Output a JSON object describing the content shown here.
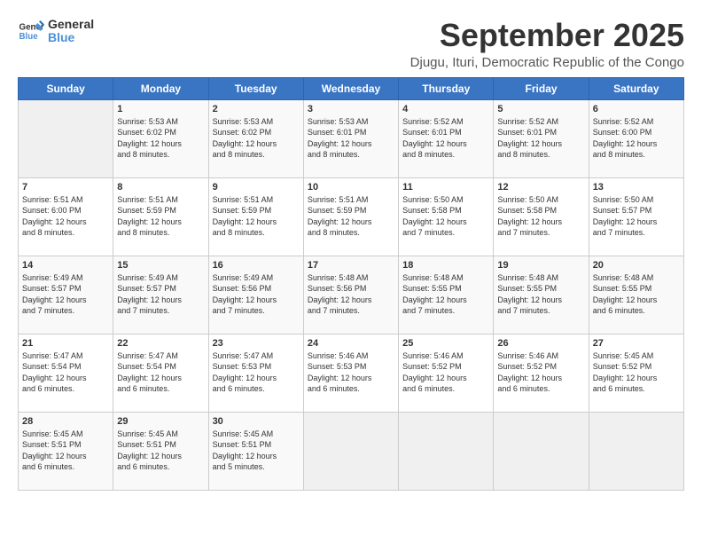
{
  "logo": {
    "line1": "General",
    "line2": "Blue"
  },
  "title": "September 2025",
  "subtitle": "Djugu, Ituri, Democratic Republic of the Congo",
  "days_of_week": [
    "Sunday",
    "Monday",
    "Tuesday",
    "Wednesday",
    "Thursday",
    "Friday",
    "Saturday"
  ],
  "weeks": [
    [
      {
        "day": "",
        "info": ""
      },
      {
        "day": "1",
        "info": "Sunrise: 5:53 AM\nSunset: 6:02 PM\nDaylight: 12 hours\nand 8 minutes."
      },
      {
        "day": "2",
        "info": "Sunrise: 5:53 AM\nSunset: 6:02 PM\nDaylight: 12 hours\nand 8 minutes."
      },
      {
        "day": "3",
        "info": "Sunrise: 5:53 AM\nSunset: 6:01 PM\nDaylight: 12 hours\nand 8 minutes."
      },
      {
        "day": "4",
        "info": "Sunrise: 5:52 AM\nSunset: 6:01 PM\nDaylight: 12 hours\nand 8 minutes."
      },
      {
        "day": "5",
        "info": "Sunrise: 5:52 AM\nSunset: 6:01 PM\nDaylight: 12 hours\nand 8 minutes."
      },
      {
        "day": "6",
        "info": "Sunrise: 5:52 AM\nSunset: 6:00 PM\nDaylight: 12 hours\nand 8 minutes."
      }
    ],
    [
      {
        "day": "7",
        "info": "Sunrise: 5:51 AM\nSunset: 6:00 PM\nDaylight: 12 hours\nand 8 minutes."
      },
      {
        "day": "8",
        "info": "Sunrise: 5:51 AM\nSunset: 5:59 PM\nDaylight: 12 hours\nand 8 minutes."
      },
      {
        "day": "9",
        "info": "Sunrise: 5:51 AM\nSunset: 5:59 PM\nDaylight: 12 hours\nand 8 minutes."
      },
      {
        "day": "10",
        "info": "Sunrise: 5:51 AM\nSunset: 5:59 PM\nDaylight: 12 hours\nand 8 minutes."
      },
      {
        "day": "11",
        "info": "Sunrise: 5:50 AM\nSunset: 5:58 PM\nDaylight: 12 hours\nand 7 minutes."
      },
      {
        "day": "12",
        "info": "Sunrise: 5:50 AM\nSunset: 5:58 PM\nDaylight: 12 hours\nand 7 minutes."
      },
      {
        "day": "13",
        "info": "Sunrise: 5:50 AM\nSunset: 5:57 PM\nDaylight: 12 hours\nand 7 minutes."
      }
    ],
    [
      {
        "day": "14",
        "info": "Sunrise: 5:49 AM\nSunset: 5:57 PM\nDaylight: 12 hours\nand 7 minutes."
      },
      {
        "day": "15",
        "info": "Sunrise: 5:49 AM\nSunset: 5:57 PM\nDaylight: 12 hours\nand 7 minutes."
      },
      {
        "day": "16",
        "info": "Sunrise: 5:49 AM\nSunset: 5:56 PM\nDaylight: 12 hours\nand 7 minutes."
      },
      {
        "day": "17",
        "info": "Sunrise: 5:48 AM\nSunset: 5:56 PM\nDaylight: 12 hours\nand 7 minutes."
      },
      {
        "day": "18",
        "info": "Sunrise: 5:48 AM\nSunset: 5:55 PM\nDaylight: 12 hours\nand 7 minutes."
      },
      {
        "day": "19",
        "info": "Sunrise: 5:48 AM\nSunset: 5:55 PM\nDaylight: 12 hours\nand 7 minutes."
      },
      {
        "day": "20",
        "info": "Sunrise: 5:48 AM\nSunset: 5:55 PM\nDaylight: 12 hours\nand 6 minutes."
      }
    ],
    [
      {
        "day": "21",
        "info": "Sunrise: 5:47 AM\nSunset: 5:54 PM\nDaylight: 12 hours\nand 6 minutes."
      },
      {
        "day": "22",
        "info": "Sunrise: 5:47 AM\nSunset: 5:54 PM\nDaylight: 12 hours\nand 6 minutes."
      },
      {
        "day": "23",
        "info": "Sunrise: 5:47 AM\nSunset: 5:53 PM\nDaylight: 12 hours\nand 6 minutes."
      },
      {
        "day": "24",
        "info": "Sunrise: 5:46 AM\nSunset: 5:53 PM\nDaylight: 12 hours\nand 6 minutes."
      },
      {
        "day": "25",
        "info": "Sunrise: 5:46 AM\nSunset: 5:52 PM\nDaylight: 12 hours\nand 6 minutes."
      },
      {
        "day": "26",
        "info": "Sunrise: 5:46 AM\nSunset: 5:52 PM\nDaylight: 12 hours\nand 6 minutes."
      },
      {
        "day": "27",
        "info": "Sunrise: 5:45 AM\nSunset: 5:52 PM\nDaylight: 12 hours\nand 6 minutes."
      }
    ],
    [
      {
        "day": "28",
        "info": "Sunrise: 5:45 AM\nSunset: 5:51 PM\nDaylight: 12 hours\nand 6 minutes."
      },
      {
        "day": "29",
        "info": "Sunrise: 5:45 AM\nSunset: 5:51 PM\nDaylight: 12 hours\nand 6 minutes."
      },
      {
        "day": "30",
        "info": "Sunrise: 5:45 AM\nSunset: 5:51 PM\nDaylight: 12 hours\nand 5 minutes."
      },
      {
        "day": "",
        "info": ""
      },
      {
        "day": "",
        "info": ""
      },
      {
        "day": "",
        "info": ""
      },
      {
        "day": "",
        "info": ""
      }
    ]
  ]
}
